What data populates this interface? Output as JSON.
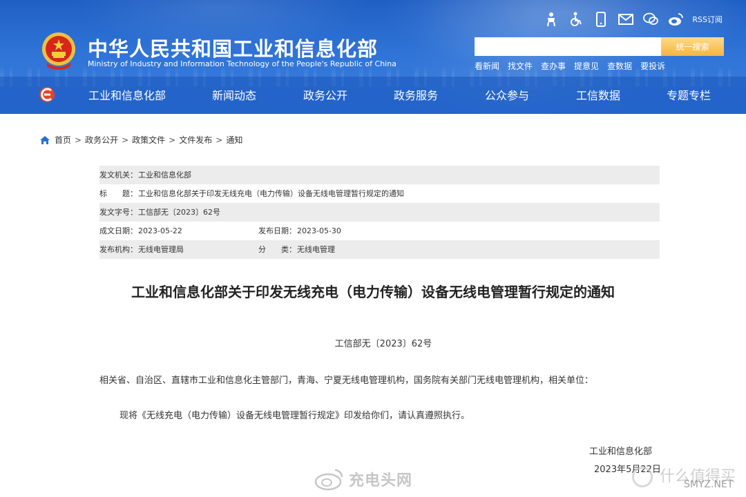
{
  "header": {
    "title": "中华人民共和国工业和信息化部",
    "subtitle": "Ministry of Industry and Information Technology of the People's Republic of China",
    "top_icons": [
      "accessibility-elder-icon",
      "wheelchair-icon",
      "mobile-icon",
      "mail-icon",
      "wechat-icon",
      "weibo-icon"
    ],
    "rss_label": "RSS订阅",
    "search": {
      "placeholder": "",
      "button_label": "统一搜索"
    },
    "quick_links": [
      "看新闻",
      "找文件",
      "查办事",
      "提意见",
      "查数据",
      "要投诉"
    ],
    "nav": [
      "工业和信息化部",
      "新闻动态",
      "政务公开",
      "政务服务",
      "公众参与",
      "工信数据",
      "专题专栏"
    ]
  },
  "breadcrumb": [
    "首页",
    "政务公开",
    "政策文件",
    "文件发布",
    "通知"
  ],
  "info": {
    "issuer_label": "发文机关：",
    "issuer": "工业和信息化部",
    "title_label": "标　　题：",
    "title": "工业和信息化部关于印发无线充电（电力传输）设备无线电管理暂行规定的通知",
    "docno_label": "发文字号：",
    "docno": "工信部无〔2023〕62号",
    "created_label": "成文日期：",
    "created": "2023-05-22",
    "published_label": "发布日期：",
    "published": "2023-05-30",
    "agency_label": "发布机构：",
    "agency": "无线电管理局",
    "category_label": "分　　类：",
    "category": "无线电管理"
  },
  "document": {
    "title": "工业和信息化部关于印发无线充电（电力传输）设备无线电管理暂行规定的通知",
    "number": "工信部无〔2023〕62号",
    "recipients": "相关省、自治区、直辖市工业和信息化主管部门，青海、宁夏无线电管理机构，国务院有关部门无线电管理机构，相关单位：",
    "body": "现将《无线充电（电力传输）设备无线电管理暂行规定》印发给你们，请认真遵照执行。",
    "sign_org": "工业和信息化部",
    "sign_date": "2023年5月22日"
  },
  "watermarks": {
    "left": "充电头网",
    "right_cn": "什么值得买",
    "right_en": "SMYZ.NET"
  },
  "colors": {
    "header_blue": "#2f73d6",
    "search_button": "#f6b540",
    "info_row_shade": "#ececec"
  }
}
